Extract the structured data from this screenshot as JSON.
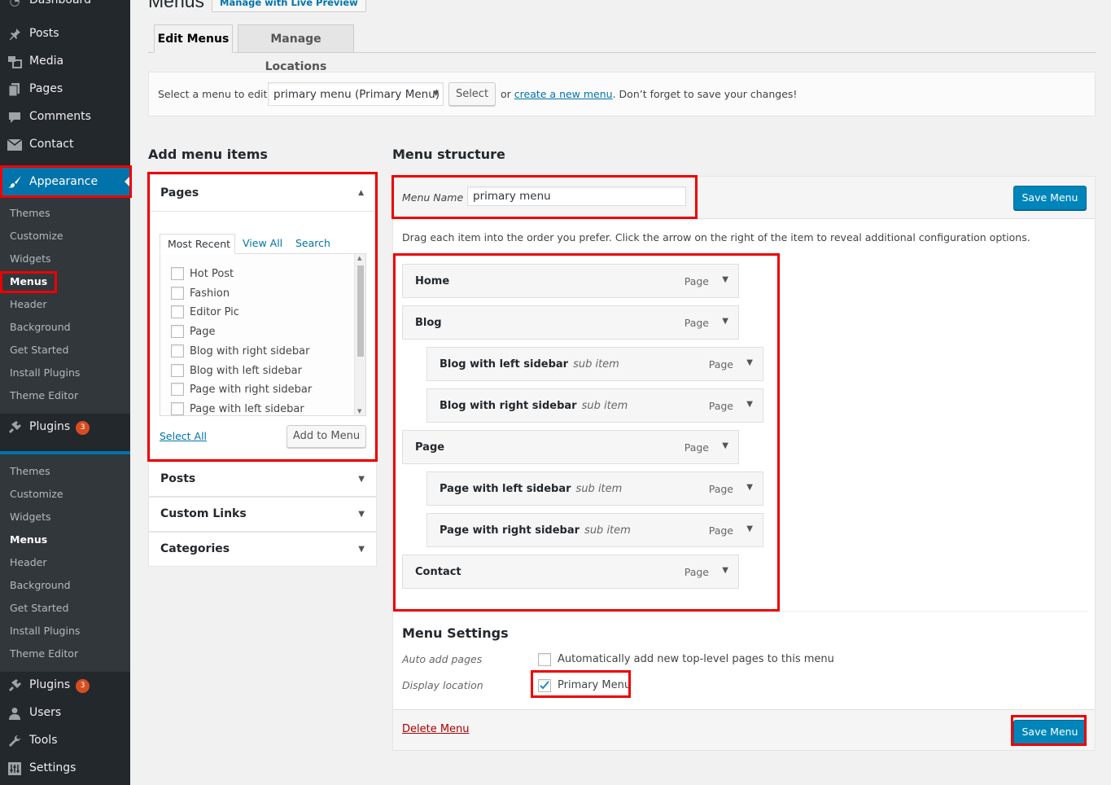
{
  "sidebar": {
    "top_cut": "Dashboard",
    "items_top": [
      {
        "label": "Posts",
        "icon": "pin-icon"
      },
      {
        "label": "Media",
        "icon": "media-icon"
      },
      {
        "label": "Pages",
        "icon": "pages-icon"
      },
      {
        "label": "Comments",
        "icon": "comments-icon"
      },
      {
        "label": "Contact",
        "icon": "mail-icon"
      }
    ],
    "appearance": "Appearance",
    "submenu1": [
      "Themes",
      "Customize",
      "Widgets",
      "Menus",
      "Header",
      "Background",
      "Get Started",
      "Install Plugins",
      "Theme Editor"
    ],
    "plugins": "Plugins",
    "plugins_badge": "3",
    "submenu2": [
      "Themes",
      "Customize",
      "Widgets",
      "Menus",
      "Header",
      "Background",
      "Get Started",
      "Install Plugins",
      "Theme Editor"
    ],
    "items_bottom": [
      {
        "label": "Plugins",
        "badge": "3"
      },
      {
        "label": "Users"
      },
      {
        "label": "Tools"
      },
      {
        "label": "Settings"
      }
    ]
  },
  "header": {
    "title": "Menus",
    "live_preview": "Manage with Live Preview"
  },
  "tabs": [
    "Edit Menus",
    "Manage Locations"
  ],
  "select_bar": {
    "label": "Select a menu to edit:",
    "selected": "primary menu (Primary Menu)",
    "select_btn": "Select",
    "or": "or",
    "create_link": "create a new menu",
    "note": ". Don’t forget to save your changes!"
  },
  "add_items": {
    "heading": "Add menu items",
    "pages_heading": "Pages",
    "subtabs": [
      "Most Recent",
      "View All",
      "Search"
    ],
    "pages": [
      "Hot Post",
      "Fashion",
      "Editor Pic",
      "Page",
      "Blog with right sidebar",
      "Blog with left sidebar",
      "Page with right sidebar",
      "Page with left sidebar"
    ],
    "select_all": "Select All",
    "add_to_menu": "Add to Menu",
    "sections": [
      "Posts",
      "Custom Links",
      "Categories"
    ]
  },
  "structure": {
    "heading": "Menu structure",
    "name_label": "Menu Name",
    "name_value": "primary menu",
    "save": "Save Menu",
    "instructions": "Drag each item into the order you prefer. Click the arrow on the right of the item to reveal additional configuration options.",
    "items": [
      {
        "title": "Home",
        "sub": "",
        "type": "Page"
      },
      {
        "title": "Blog",
        "sub": "",
        "type": "Page"
      },
      {
        "title": "Blog with left sidebar",
        "sub": "sub item",
        "type": "Page"
      },
      {
        "title": "Blog with right sidebar",
        "sub": "sub item",
        "type": "Page"
      },
      {
        "title": "Page",
        "sub": "",
        "type": "Page"
      },
      {
        "title": "Page with left sidebar",
        "sub": "sub item",
        "type": "Page"
      },
      {
        "title": "Page with right sidebar",
        "sub": "sub item",
        "type": "Page"
      },
      {
        "title": "Contact",
        "sub": "",
        "type": "Page"
      }
    ]
  },
  "settings": {
    "heading": "Menu Settings",
    "auto_label": "Auto add pages",
    "auto_text": "Automatically add new top-level pages to this menu",
    "display_label": "Display location",
    "primary_menu": "Primary Menu",
    "delete": "Delete Menu",
    "save": "Save Menu"
  }
}
